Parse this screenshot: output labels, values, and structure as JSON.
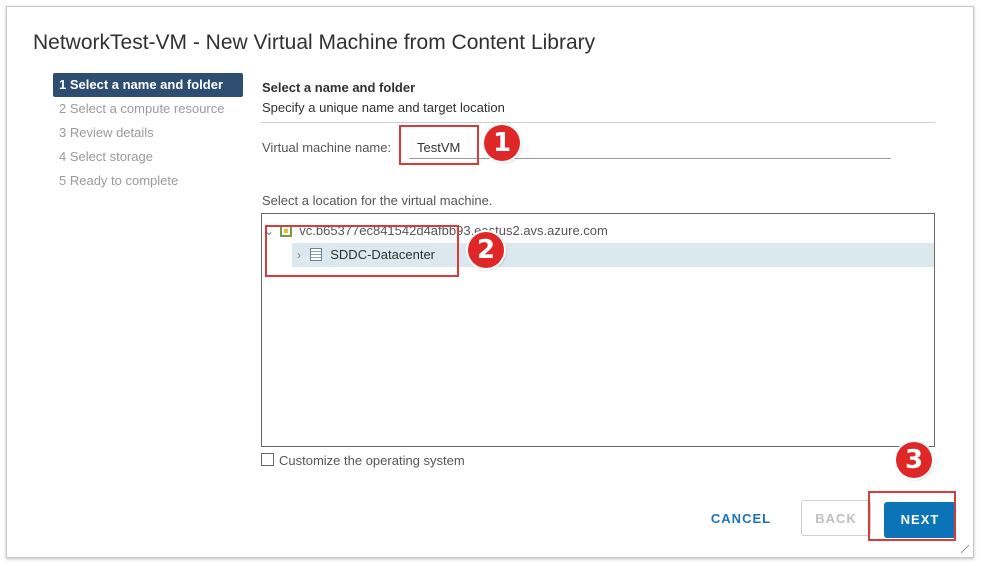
{
  "dialog": {
    "title": "NetworkTest-VM - New Virtual Machine from Content Library"
  },
  "steps": [
    {
      "label": "1 Select a name and folder",
      "active": true
    },
    {
      "label": "2 Select a compute resource",
      "active": false
    },
    {
      "label": "3 Review details",
      "active": false
    },
    {
      "label": "4 Select storage",
      "active": false
    },
    {
      "label": "5 Ready to complete",
      "active": false
    }
  ],
  "section": {
    "title": "Select a name and folder",
    "subtitle": "Specify a unique name and target location"
  },
  "vm_name": {
    "label": "Virtual machine name:",
    "value": "TestVM"
  },
  "location": {
    "label": "Select a location for the virtual machine.",
    "tree": {
      "root": {
        "label": "vc.b65377ec841542d4afbb93.eastus2.avs.azure.com",
        "icon": "vcenter-icon",
        "expanded": true
      },
      "child": {
        "label": "SDDC-Datacenter",
        "icon": "datacenter-icon",
        "selected": true
      }
    }
  },
  "options": {
    "customize_os": {
      "label": "Customize the operating system",
      "checked": false
    }
  },
  "buttons": {
    "cancel": "CANCEL",
    "back": "BACK",
    "next": "NEXT"
  },
  "annotations": [
    "1",
    "2",
    "3"
  ],
  "colors": {
    "active_step": "#2d4e70",
    "primary": "#0b74b8",
    "annotation_red": "#e02727",
    "selected_row": "#dbe8ee"
  }
}
